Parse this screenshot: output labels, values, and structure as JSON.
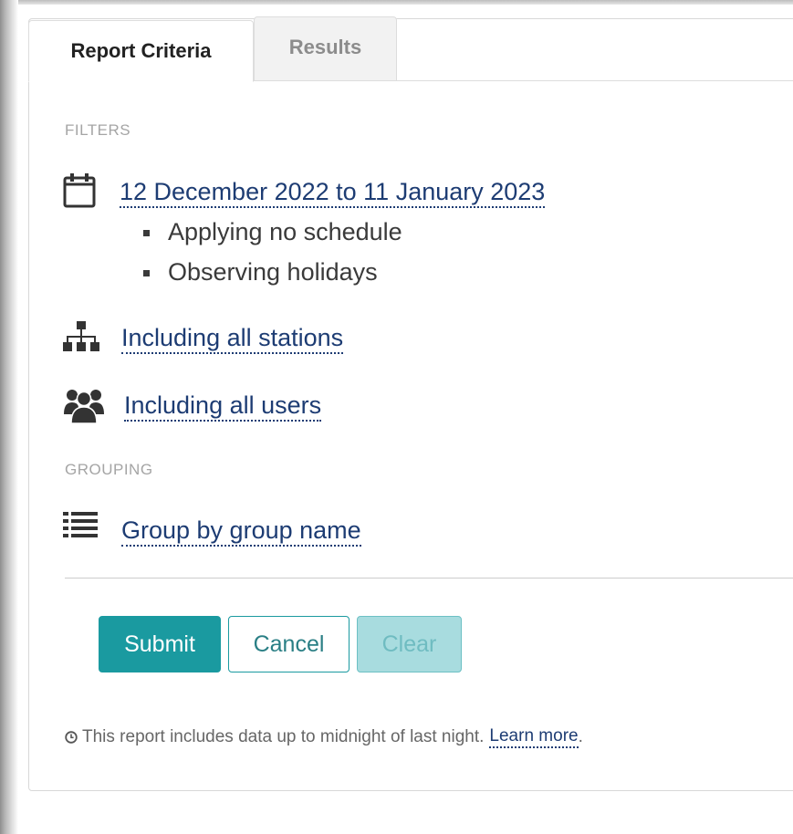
{
  "tabs": {
    "active": "Report Criteria",
    "inactive": "Results"
  },
  "filters": {
    "section_label": "FILTERS",
    "date_range": "12 December 2022 to 11 January 2023",
    "date_details": [
      "Applying no schedule",
      "Observing holidays"
    ],
    "stations": "Including all stations",
    "users": "Including all users"
  },
  "grouping": {
    "section_label": "GROUPING",
    "group_by": "Group by group name"
  },
  "buttons": {
    "submit": "Submit",
    "cancel": "Cancel",
    "clear": "Clear"
  },
  "footnote": {
    "text": "This report includes data up to midnight of last night.",
    "link": "Learn more",
    "trailing": "."
  },
  "icons": {
    "date": "calendar-icon",
    "stations": "sitemap-icon",
    "users": "users-icon",
    "grouping": "list-icon",
    "footnote": "clock-icon"
  },
  "colors": {
    "accent": "#1a9aa0",
    "link": "#1d3c73",
    "muted_label": "#a5a5a5"
  }
}
